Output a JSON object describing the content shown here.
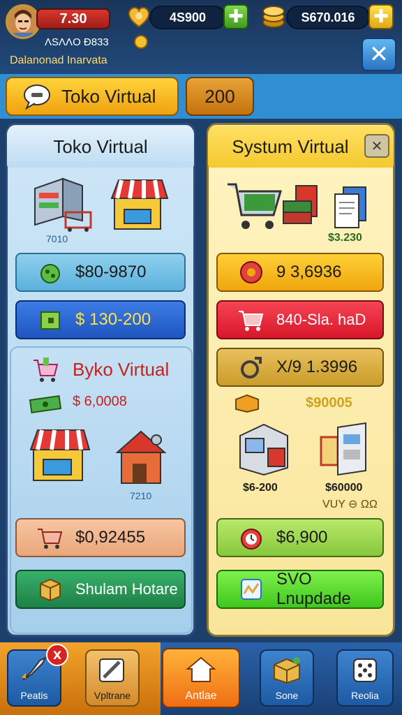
{
  "hud": {
    "level": "7.30",
    "coins": "4S900",
    "gems": "S670.016",
    "player_line": "ΛSΛΛO Ð833",
    "subtitle": "Dalanonad Inarvata"
  },
  "tabs": {
    "main_label": "Toko Virtual",
    "badge_value": "200"
  },
  "left_panel": {
    "title": "Toko Virtual",
    "shop_note": "7010",
    "btn_1": "$80-9870",
    "btn_2": "$ 130-200",
    "sub_section": {
      "title": "Byko Virtual",
      "price": "$ 6,0008",
      "note": "7210"
    },
    "btn_3": "$0,92455",
    "btn_4": "Shulam Hotare"
  },
  "right_panel": {
    "title": "Systum Virtual",
    "shop_note": "$3.230",
    "btn_1": "9 3,6936",
    "btn_2": "840-Sla. haD",
    "btn_3": "X/9 1.3996",
    "gold_value": "$90005",
    "item_price": "$6-200",
    "item_price_2": "$60000",
    "item_note": "VUY ⊖ ΩΩ",
    "btn_4": "$6,900",
    "btn_5": "SVO Lnupdade"
  },
  "bottom_nav": {
    "items": [
      "Peatis",
      "Vpltrane",
      "Antlae",
      "Sone",
      "Reolia"
    ],
    "badge": "X"
  },
  "colors": {
    "accent_yellow": "#f0a20f",
    "accent_blue": "#2f8fd2",
    "left_panel_bg": "#cfe7f7",
    "right_panel_bg": "#fff4c2"
  }
}
